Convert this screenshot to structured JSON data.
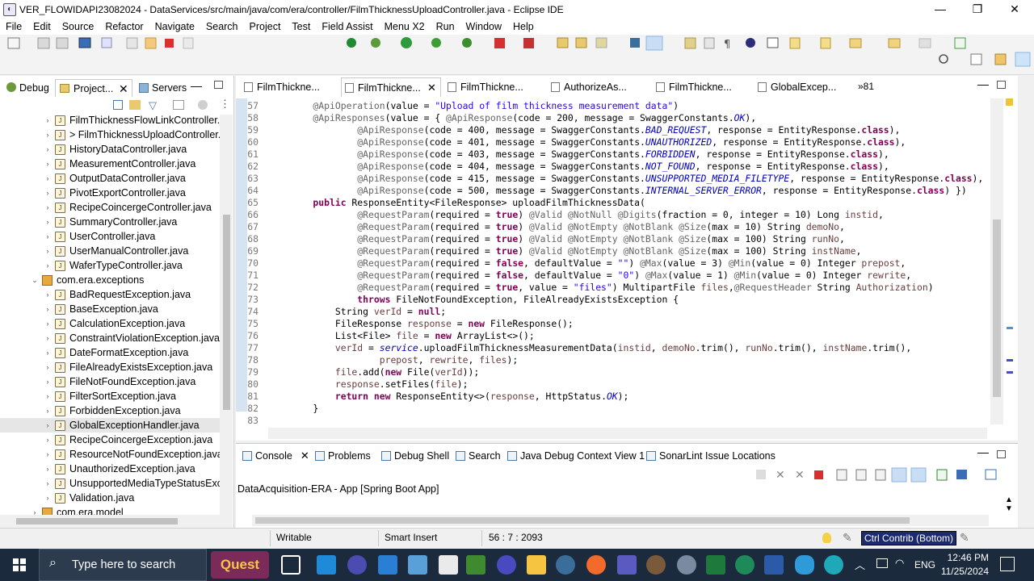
{
  "window": {
    "title": "VER_FLOWIDAPI23082024 - DataServices/src/main/java/com/era/controller/FilmThicknessUploadController.java - Eclipse IDE",
    "controls": [
      "—",
      "❐",
      "✕"
    ]
  },
  "menu": [
    "File",
    "Edit",
    "Source",
    "Refactor",
    "Navigate",
    "Search",
    "Project",
    "Test",
    "Field Assist",
    "Menu X2",
    "Run",
    "Window",
    "Help"
  ],
  "left_panel": {
    "tabs": [
      "Debug",
      "Project...",
      "Servers"
    ],
    "tree": [
      {
        "label": "FilmThicknessFlowLinkController.ja",
        "type": "java",
        "level": 2,
        "selected": false
      },
      {
        "label": "> FilmThicknessUploadController.j",
        "type": "java",
        "level": 2,
        "selected": false
      },
      {
        "label": "HistoryDataController.java",
        "type": "java",
        "level": 2,
        "selected": false
      },
      {
        "label": "MeasurementController.java",
        "type": "java",
        "level": 2,
        "selected": false
      },
      {
        "label": "OutputDataController.java",
        "type": "java",
        "level": 2,
        "selected": false
      },
      {
        "label": "PivotExportController.java",
        "type": "java",
        "level": 2,
        "selected": false
      },
      {
        "label": "RecipeCoincergeController.java",
        "type": "java",
        "level": 2,
        "selected": false
      },
      {
        "label": "SummaryController.java",
        "type": "java",
        "level": 2,
        "selected": false
      },
      {
        "label": "UserController.java",
        "type": "java",
        "level": 2,
        "selected": false
      },
      {
        "label": "UserManualController.java",
        "type": "java",
        "level": 2,
        "selected": false
      },
      {
        "label": "WaferTypeController.java",
        "type": "java",
        "level": 2,
        "selected": false
      },
      {
        "label": "com.era.exceptions",
        "type": "package",
        "level": 1,
        "selected": false
      },
      {
        "label": "BadRequestException.java",
        "type": "java",
        "level": 2,
        "selected": false
      },
      {
        "label": "BaseException.java",
        "type": "java",
        "level": 2,
        "selected": false
      },
      {
        "label": "CalculationException.java",
        "type": "java",
        "level": 2,
        "selected": false
      },
      {
        "label": "ConstraintViolationException.java",
        "type": "java",
        "level": 2,
        "selected": false
      },
      {
        "label": "DateFormatException.java",
        "type": "java",
        "level": 2,
        "selected": false
      },
      {
        "label": "FileAlreadyExistsException.java",
        "type": "java",
        "level": 2,
        "selected": false
      },
      {
        "label": "FileNotFoundException.java",
        "type": "java",
        "level": 2,
        "selected": false
      },
      {
        "label": "FilterSortException.java",
        "type": "java",
        "level": 2,
        "selected": false
      },
      {
        "label": "ForbiddenException.java",
        "type": "java",
        "level": 2,
        "selected": false
      },
      {
        "label": "GlobalExceptionHandler.java",
        "type": "java",
        "level": 2,
        "selected": true
      },
      {
        "label": "RecipeCoincergeException.java",
        "type": "java",
        "level": 2,
        "selected": false
      },
      {
        "label": "ResourceNotFoundException.java",
        "type": "java",
        "level": 2,
        "selected": false
      },
      {
        "label": "UnauthorizedException.java",
        "type": "java",
        "level": 2,
        "selected": false
      },
      {
        "label": "UnsupportedMediaTypeStatusExce",
        "type": "java",
        "level": 2,
        "selected": false
      },
      {
        "label": "Validation.java",
        "type": "java",
        "level": 2,
        "selected": false
      },
      {
        "label": "com.era.model",
        "type": "package",
        "level": 1,
        "selected": false
      }
    ]
  },
  "editor": {
    "tabs": [
      {
        "label": "FilmThickne...",
        "active": false
      },
      {
        "label": "FilmThickne...",
        "active": true
      },
      {
        "label": "FilmThickne...",
        "active": false
      },
      {
        "label": "AuthorizeAs...",
        "active": false
      },
      {
        "label": "FilmThickne...",
        "active": false
      },
      {
        "label": "GlobalExcep...",
        "active": false
      }
    ],
    "overflow_count": "»81",
    "lines": [
      {
        "n": "57",
        "t": [
          [
            "ann",
            "    @ApiOperation"
          ],
          [
            "id",
            "(value = "
          ],
          [
            "str",
            "\"Upload of film thickness measurement data\""
          ],
          [
            "id",
            ")"
          ]
        ]
      },
      {
        "n": "58",
        "t": [
          [
            "ann",
            "    @ApiResponses"
          ],
          [
            "id",
            "(value = { "
          ],
          [
            "ann",
            "@ApiResponse"
          ],
          [
            "id",
            "(code = 200, message = SwaggerConstants."
          ],
          [
            "fld",
            "OK"
          ],
          [
            "id",
            "),"
          ]
        ]
      },
      {
        "n": "59",
        "t": [
          [
            "ann",
            "            @ApiResponse"
          ],
          [
            "id",
            "(code = 400, message = SwaggerConstants."
          ],
          [
            "fld",
            "BAD_REQUEST"
          ],
          [
            "id",
            ", response = EntityResponse."
          ],
          [
            "kw",
            "class"
          ],
          [
            "id",
            "),"
          ]
        ]
      },
      {
        "n": "60",
        "t": [
          [
            "ann",
            "            @ApiResponse"
          ],
          [
            "id",
            "(code = 401, message = SwaggerConstants."
          ],
          [
            "fld",
            "UNAUTHORIZED"
          ],
          [
            "id",
            ", response = EntityResponse."
          ],
          [
            "kw",
            "class"
          ],
          [
            "id",
            "),"
          ]
        ]
      },
      {
        "n": "61",
        "t": [
          [
            "ann",
            "            @ApiResponse"
          ],
          [
            "id",
            "(code = 403, message = SwaggerConstants."
          ],
          [
            "fld",
            "FORBIDDEN"
          ],
          [
            "id",
            ", response = EntityResponse."
          ],
          [
            "kw",
            "class"
          ],
          [
            "id",
            "),"
          ]
        ]
      },
      {
        "n": "62",
        "t": [
          [
            "ann",
            "            @ApiResponse"
          ],
          [
            "id",
            "(code = 404, message = SwaggerConstants."
          ],
          [
            "fld",
            "NOT_FOUND"
          ],
          [
            "id",
            ", response = EntityResponse."
          ],
          [
            "kw",
            "class"
          ],
          [
            "id",
            "),"
          ]
        ]
      },
      {
        "n": "63",
        "t": [
          [
            "ann",
            "            @ApiResponse"
          ],
          [
            "id",
            "(code = 415, message = SwaggerConstants."
          ],
          [
            "fld",
            "UNSUPPORTED_MEDIA_FILETYPE"
          ],
          [
            "id",
            ", response = EntityResponse."
          ],
          [
            "kw",
            "class"
          ],
          [
            "id",
            "),"
          ]
        ]
      },
      {
        "n": "64",
        "t": [
          [
            "ann",
            "            @ApiResponse"
          ],
          [
            "id",
            "(code = 500, message = SwaggerConstants."
          ],
          [
            "fld",
            "INTERNAL_SERVER_ERROR"
          ],
          [
            "id",
            ", response = EntityResponse."
          ],
          [
            "kw",
            "class"
          ],
          [
            "id",
            ") })"
          ]
        ]
      },
      {
        "n": "65",
        "t": [
          [
            "kw",
            "    public"
          ],
          [
            "id",
            " ResponseEntity<FileResponse> uploadFilmThicknessData("
          ]
        ]
      },
      {
        "n": "66",
        "t": [
          [
            "ann",
            "            @RequestParam"
          ],
          [
            "id",
            "(required = "
          ],
          [
            "kw",
            "true"
          ],
          [
            "id",
            ") "
          ],
          [
            "ann",
            "@Valid @NotNull @Digits"
          ],
          [
            "id",
            "(fraction = 0, integer = 10) Long "
          ],
          [
            "var",
            "instid"
          ],
          [
            "id",
            ","
          ]
        ]
      },
      {
        "n": "67",
        "t": [
          [
            "ann",
            "            @RequestParam"
          ],
          [
            "id",
            "(required = "
          ],
          [
            "kw",
            "true"
          ],
          [
            "id",
            ") "
          ],
          [
            "ann",
            "@Valid @NotEmpty @NotBlank @Size"
          ],
          [
            "id",
            "(max = 10) String "
          ],
          [
            "var",
            "demoNo"
          ],
          [
            "id",
            ","
          ]
        ]
      },
      {
        "n": "68",
        "t": [
          [
            "ann",
            "            @RequestParam"
          ],
          [
            "id",
            "(required = "
          ],
          [
            "kw",
            "true"
          ],
          [
            "id",
            ") "
          ],
          [
            "ann",
            "@Valid @NotEmpty @NotBlank @Size"
          ],
          [
            "id",
            "(max = 100) String "
          ],
          [
            "var",
            "runNo"
          ],
          [
            "id",
            ","
          ]
        ]
      },
      {
        "n": "69",
        "t": [
          [
            "ann",
            "            @RequestParam"
          ],
          [
            "id",
            "(required = "
          ],
          [
            "kw",
            "true"
          ],
          [
            "id",
            ") "
          ],
          [
            "ann",
            "@Valid @NotEmpty @NotBlank @Size"
          ],
          [
            "id",
            "(max = 100) String "
          ],
          [
            "var",
            "instName"
          ],
          [
            "id",
            ","
          ]
        ]
      },
      {
        "n": "70",
        "t": [
          [
            "ann",
            "            @RequestParam"
          ],
          [
            "id",
            "(required = "
          ],
          [
            "kw",
            "false"
          ],
          [
            "id",
            ", defaultValue = "
          ],
          [
            "str",
            "\"\""
          ],
          [
            "id",
            ") "
          ],
          [
            "ann",
            "@Max"
          ],
          [
            "id",
            "(value = 3) "
          ],
          [
            "ann",
            "@Min"
          ],
          [
            "id",
            "(value = 0) Integer "
          ],
          [
            "var",
            "prepost"
          ],
          [
            "id",
            ","
          ]
        ]
      },
      {
        "n": "71",
        "t": [
          [
            "ann",
            "            @RequestParam"
          ],
          [
            "id",
            "(required = "
          ],
          [
            "kw",
            "false"
          ],
          [
            "id",
            ", defaultValue = "
          ],
          [
            "str",
            "\"0\""
          ],
          [
            "id",
            ") "
          ],
          [
            "ann",
            "@Max"
          ],
          [
            "id",
            "(value = 1) "
          ],
          [
            "ann",
            "@Min"
          ],
          [
            "id",
            "(value = 0) Integer "
          ],
          [
            "var",
            "rewrite"
          ],
          [
            "id",
            ","
          ]
        ]
      },
      {
        "n": "72",
        "t": [
          [
            "ann",
            "            @RequestParam"
          ],
          [
            "id",
            "(required = "
          ],
          [
            "kw",
            "true"
          ],
          [
            "id",
            ", value = "
          ],
          [
            "str",
            "\"files\""
          ],
          [
            "id",
            ") MultipartFile "
          ],
          [
            "var",
            "files"
          ],
          [
            "id",
            ","
          ],
          [
            "ann",
            "@RequestHeader"
          ],
          [
            "id",
            " String "
          ],
          [
            "var",
            "Authorization"
          ],
          [
            "id",
            ")"
          ]
        ]
      },
      {
        "n": "73",
        "t": [
          [
            "kw",
            "            throws"
          ],
          [
            "id",
            " FileNotFoundException, FileAlreadyExistsException {"
          ]
        ]
      },
      {
        "n": "74",
        "t": [
          [
            "id",
            "        String "
          ],
          [
            "var",
            "verId"
          ],
          [
            "id",
            " = "
          ],
          [
            "kw",
            "null"
          ],
          [
            "id",
            ";"
          ]
        ]
      },
      {
        "n": "75",
        "t": [
          [
            "id",
            "        FileResponse "
          ],
          [
            "var",
            "response"
          ],
          [
            "id",
            " = "
          ],
          [
            "kw",
            "new"
          ],
          [
            "id",
            " FileResponse();"
          ]
        ]
      },
      {
        "n": "76",
        "t": [
          [
            "id",
            "        List<File> "
          ],
          [
            "var",
            "file"
          ],
          [
            "id",
            " = "
          ],
          [
            "kw",
            "new"
          ],
          [
            "id",
            " ArrayList<>();"
          ]
        ]
      },
      {
        "n": "77",
        "t": [
          [
            "var",
            "        verId"
          ],
          [
            "id",
            " = "
          ],
          [
            "fld",
            "service"
          ],
          [
            "id",
            ".uploadFilmThicknessMeasurementData("
          ],
          [
            "var",
            "instid"
          ],
          [
            "id",
            ", "
          ],
          [
            "var",
            "demoNo"
          ],
          [
            "id",
            ".trim(), "
          ],
          [
            "var",
            "runNo"
          ],
          [
            "id",
            ".trim(), "
          ],
          [
            "var",
            "instName"
          ],
          [
            "id",
            ".trim(),"
          ]
        ]
      },
      {
        "n": "78",
        "t": [
          [
            "var",
            "                prepost"
          ],
          [
            "id",
            ", "
          ],
          [
            "var",
            "rewrite"
          ],
          [
            "id",
            ", "
          ],
          [
            "var",
            "files"
          ],
          [
            "id",
            ");"
          ]
        ]
      },
      {
        "n": "79",
        "t": [
          [
            "var",
            "        file"
          ],
          [
            "id",
            ".add("
          ],
          [
            "kw",
            "new"
          ],
          [
            "id",
            " File("
          ],
          [
            "var",
            "verId"
          ],
          [
            "id",
            "));"
          ]
        ]
      },
      {
        "n": "80",
        "t": [
          [
            "var",
            "        response"
          ],
          [
            "id",
            ".setFiles("
          ],
          [
            "var",
            "file"
          ],
          [
            "id",
            ");"
          ]
        ]
      },
      {
        "n": "81",
        "t": [
          [
            "kw",
            "        return new"
          ],
          [
            "id",
            " ResponseEntity<>("
          ],
          [
            "var",
            "response"
          ],
          [
            "id",
            ", HttpStatus."
          ],
          [
            "fld",
            "OK"
          ],
          [
            "id",
            ");"
          ]
        ]
      },
      {
        "n": "82",
        "t": [
          [
            "id",
            "    }"
          ]
        ]
      },
      {
        "n": "83",
        "t": [
          [
            "id",
            ""
          ]
        ]
      }
    ]
  },
  "console": {
    "tabs": [
      "Console",
      "Problems",
      "Debug Shell",
      "Search",
      "Java Debug Context View 1",
      "SonarLint Issue Locations"
    ],
    "launch_label": "DataAcquisition-ERA - App [Spring Boot App]"
  },
  "status": {
    "writable": "Writable",
    "insert_mode": "Smart Insert",
    "position": "56 : 7 : 2093",
    "context_button": "Ctrl Contrib (Bottom)"
  },
  "taskbar": {
    "search_placeholder": "Type here to search",
    "widget": "Quest",
    "time": "12:46 PM",
    "date": "11/25/2024",
    "language": "ENG"
  },
  "colors": {
    "keyword": "#7f0055",
    "string": "#2a00ff",
    "annotation": "#646464",
    "static_field": "#0000c0",
    "local_var": "#6a3e3e",
    "taskbar": "#1c2a3d"
  }
}
